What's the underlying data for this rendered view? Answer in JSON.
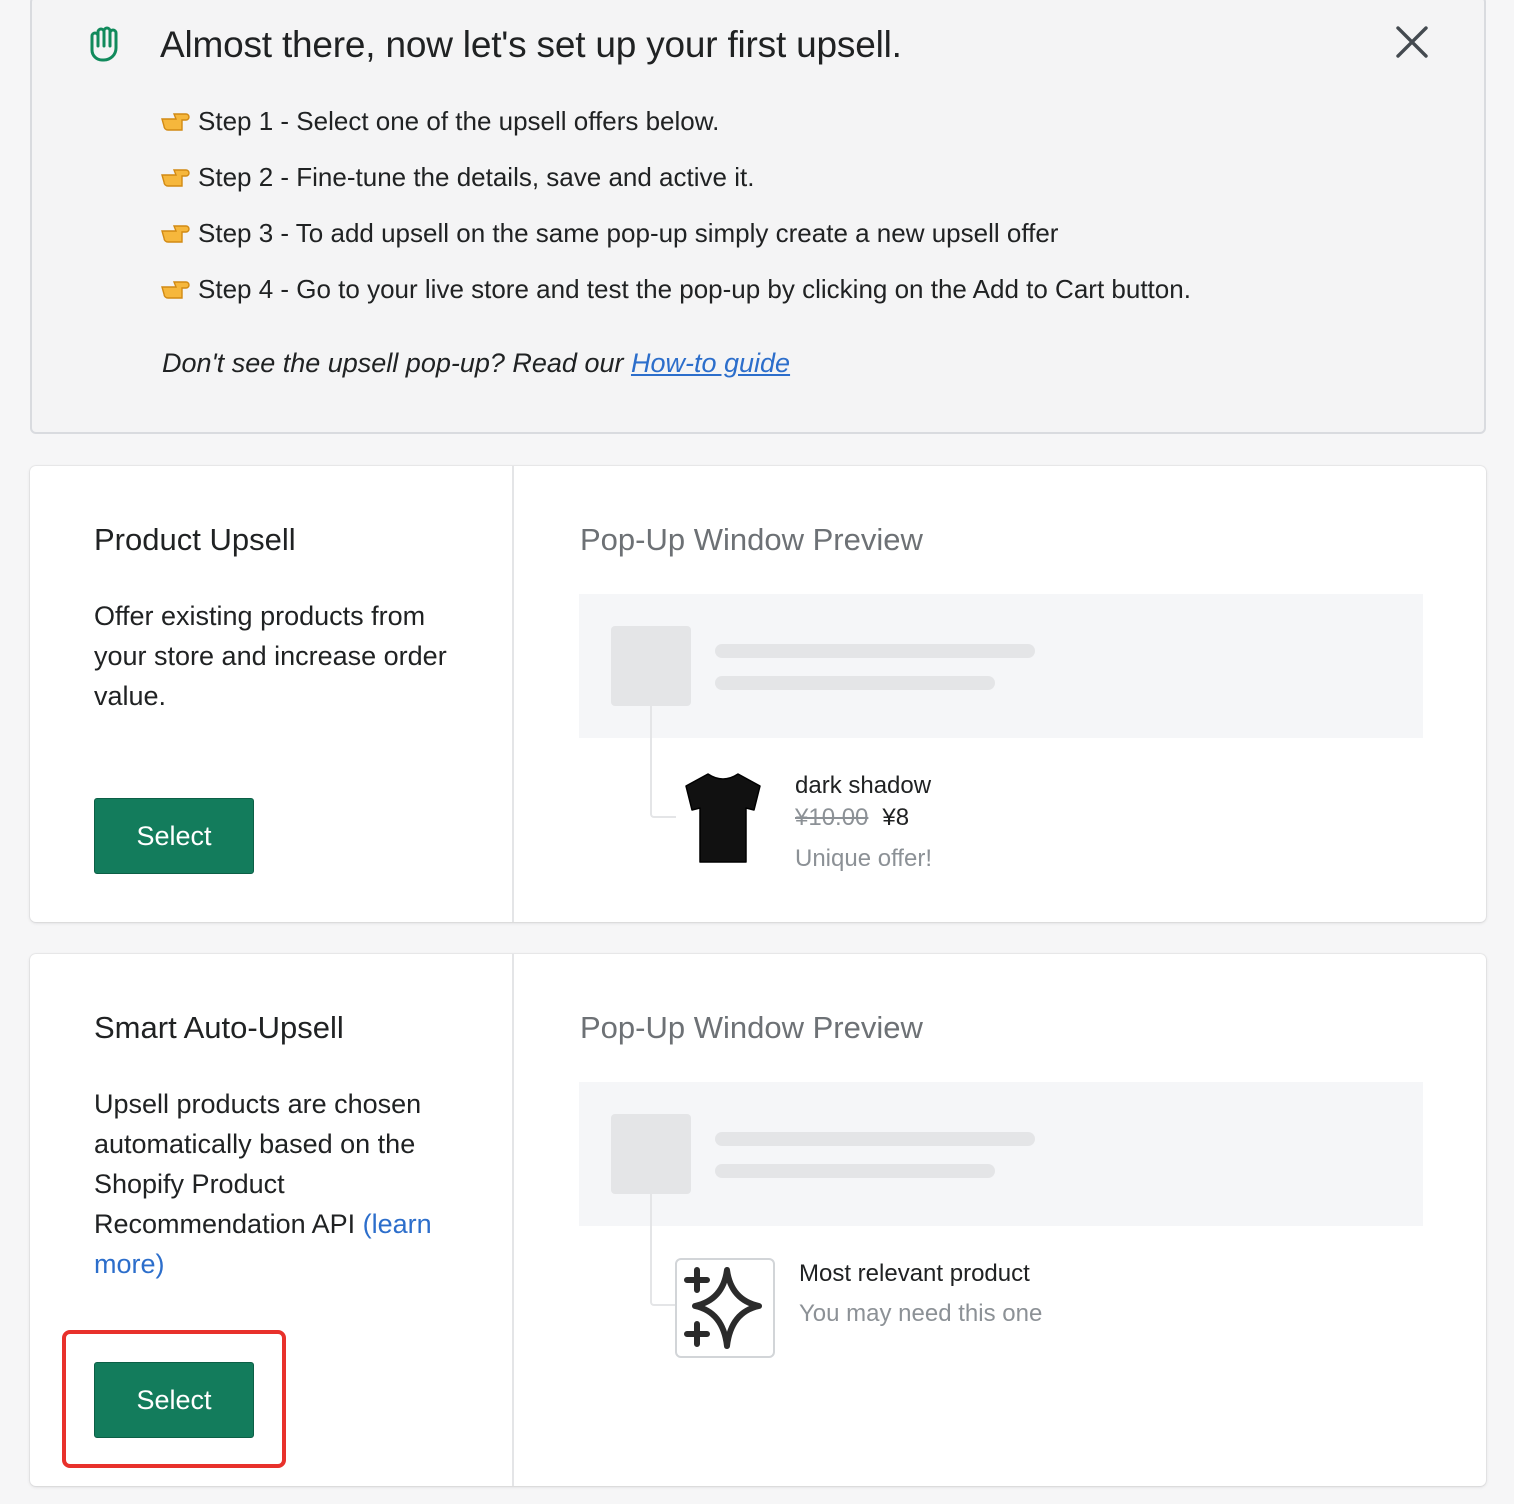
{
  "banner": {
    "title": "Almost there, now let's set up your first upsell.",
    "steps": [
      "Step 1 - Select one of the upsell offers below.",
      "Step 2 - Fine-tune the details, save and active it.",
      "Step 3 - To add upsell on the same pop-up simply create a new upsell offer",
      "Step 4 - Go to your live store and test the pop-up by clicking on the Add to Cart button."
    ],
    "help_prefix": "Don't see the upsell pop-up? Read our ",
    "help_link": "How-to guide"
  },
  "cards": [
    {
      "title": "Product Upsell",
      "description": "Offer existing products from your store and increase order value.",
      "button_label": "Select",
      "preview_title": "Pop-Up Window Preview",
      "product_name": "dark shadow",
      "price_old": "¥10.00",
      "price_new": "¥8",
      "tagline": "Unique offer!"
    },
    {
      "title": "Smart Auto-Upsell",
      "description": "Upsell products are chosen automatically based on the Shopify Product Recommendation API",
      "learn_more": "(learn more)",
      "button_label": "Select",
      "preview_title": "Pop-Up Window Preview",
      "product_name": "Most relevant product",
      "tagline": "You may need this one"
    }
  ],
  "icons": {
    "banner": "hand-icon",
    "close": "close-icon",
    "step_bullet": "pointing-hand-icon",
    "product": "tshirt-icon",
    "smart": "sparkle-icon"
  },
  "colors": {
    "primary_button": "#137c5c",
    "link": "#2c6ecb",
    "banner_icon": "#118a5c",
    "highlight_frame": "#e8312b"
  }
}
